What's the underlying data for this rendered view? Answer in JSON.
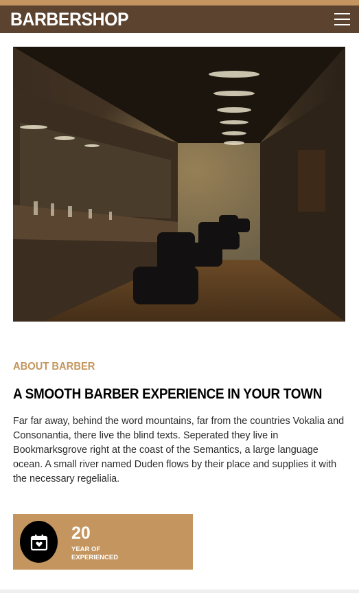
{
  "nav": {
    "brand": "BARBERSHOP",
    "menu_icon": "hamburger-menu-icon"
  },
  "hero": {
    "image": "barbershop-interior-photo"
  },
  "about": {
    "subheading": "ABOUT BARBER",
    "heading": "A SMOOTH BARBER EXPERIENCE IN YOUR TOWN",
    "body": "Far far away, behind the word mountains, far from the countries Vokalia and Consonantia, there live the blind texts. Seperated they live in Bookmarksgrove right at the coast of the Semantics, a large language ocean. A small river named Duden flows by their place and supplies it with the necessary regelialia."
  },
  "stat": {
    "icon": "calendar-heart-icon",
    "number": "20",
    "label": "YEAR OF EXPERIENCED"
  },
  "colors": {
    "accent": "#c4955f",
    "nav_bg": "#5b4330",
    "heading": "#000000",
    "icon_circle": "#000000"
  }
}
